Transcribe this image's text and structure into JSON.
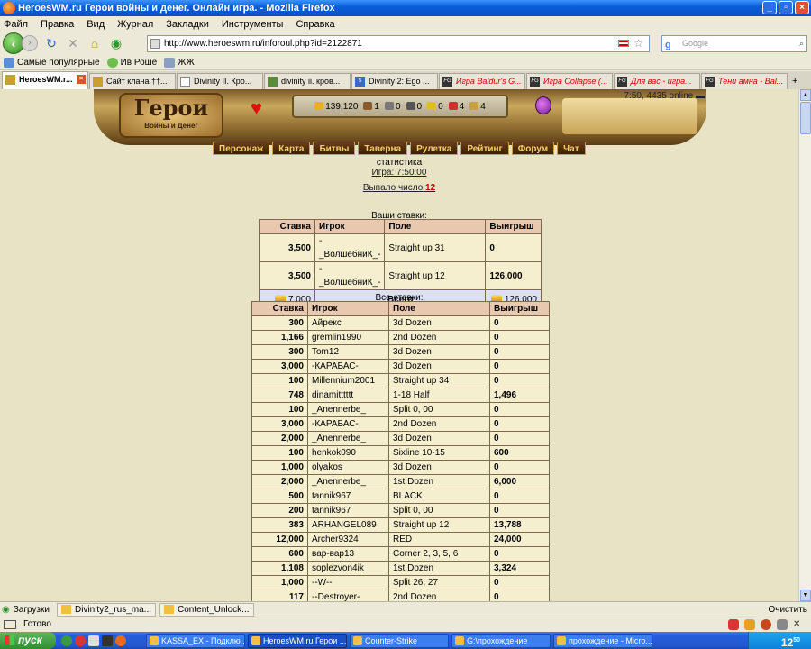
{
  "window": {
    "title": "HeroesWM.ru Герои войны и денег. Онлайн игра. - Mozilla Firefox"
  },
  "menu": [
    "Файл",
    "Правка",
    "Вид",
    "Журнал",
    "Закладки",
    "Инструменты",
    "Справка"
  ],
  "nav": {
    "url": "http://www.heroeswm.ru/inforoul.php?id=2122871",
    "search_placeholder": "Google"
  },
  "bookmarks": [
    "Самые популярные",
    "Ив Роше",
    "ЖЖ"
  ],
  "tabs": [
    {
      "label": "HeroesWM.r...",
      "active": true
    },
    {
      "label": "Сайт клана ††..."
    },
    {
      "label": "Divinity II. Кро..."
    },
    {
      "label": "divinity ii. кров..."
    },
    {
      "label": "Divinity 2: Ego ..."
    },
    {
      "label": "Игра Baldur's G...",
      "red": true
    },
    {
      "label": "Игра Collapse (...",
      "red": true
    },
    {
      "label": "Для вас - игра...",
      "red": true
    },
    {
      "label": "Тени амна - Bal...",
      "red": true
    }
  ],
  "game": {
    "logo_title": "Герои",
    "logo_sub": "Войны и Денег",
    "online": "7:50, 4435 online",
    "resources": [
      "139,120",
      "1",
      "0",
      "0",
      "0",
      "4",
      "4"
    ],
    "menu": [
      "Персонаж",
      "Карта",
      "Битвы",
      "Таверна",
      "Рулетка",
      "Рейтинг",
      "Форум",
      "Чат"
    ]
  },
  "stats": {
    "heading": "статистика",
    "game_link": "Игра: 7:50:00",
    "dropped_label": "Выпало число",
    "dropped_value": "12"
  },
  "my_bets": {
    "caption": "Ваши ставки:",
    "headers": [
      "Ставка",
      "Игрок",
      "Поле",
      "Выигрыш"
    ],
    "rows": [
      [
        "3,500",
        "-_ВолшебниК_-",
        "Straight up 31",
        "0"
      ],
      [
        "3,500",
        "-_ВолшебниК_-",
        "Straight up 12",
        "126,000"
      ]
    ],
    "total": {
      "bet": "7,000",
      "label": "Всего",
      "win": "126,000"
    }
  },
  "all_bets": {
    "caption": "Все ставки:",
    "headers": [
      "Ставка",
      "Игрок",
      "Поле",
      "Выигрыш"
    ],
    "rows": [
      [
        "300",
        "Айрекс",
        "3d Dozen",
        "0"
      ],
      [
        "1,166",
        "gremlin1990",
        "2nd Dozen",
        "0"
      ],
      [
        "300",
        "Tom12",
        "3d Dozen",
        "0"
      ],
      [
        "3,000",
        "-КАРАБАС-",
        "3d Dozen",
        "0"
      ],
      [
        "100",
        "Millennium2001",
        "Straight up 34",
        "0"
      ],
      [
        "748",
        "dinamitttttt",
        "1-18 Half",
        "1,496"
      ],
      [
        "100",
        "_Anennerbe_",
        "Split 0, 00",
        "0"
      ],
      [
        "3,000",
        "-КАРАБАС-",
        "2nd Dozen",
        "0"
      ],
      [
        "2,000",
        "_Anennerbe_",
        "3d Dozen",
        "0"
      ],
      [
        "100",
        "henkok090",
        "Sixline 10-15",
        "600"
      ],
      [
        "1,000",
        "olyakos",
        "3d Dozen",
        "0"
      ],
      [
        "2,000",
        "_Anennerbe_",
        "1st Dozen",
        "6,000"
      ],
      [
        "500",
        "tannik967",
        "BLACK",
        "0"
      ],
      [
        "200",
        "tannik967",
        "Split 0, 00",
        "0"
      ],
      [
        "383",
        "ARHANGEL089",
        "Straight up 12",
        "13,788"
      ],
      [
        "12,000",
        "Archer9324",
        "RED",
        "24,000"
      ],
      [
        "600",
        "вар-вар13",
        "Corner 2, 3, 5, 6",
        "0"
      ],
      [
        "1,108",
        "soplezvon4ik",
        "1st Dozen",
        "3,324"
      ],
      [
        "1,000",
        "--W--",
        "Split 26, 27",
        "0"
      ],
      [
        "117",
        "--Destroyer-",
        "2nd Dozen",
        "0"
      ]
    ]
  },
  "downloads": {
    "label": "Загрузки",
    "items": [
      "Divinity2_rus_ma...",
      "Content_Unlock..."
    ],
    "clear": "Очистить"
  },
  "status": "Готово",
  "taskbar": {
    "start": "пуск",
    "tasks": [
      "KASSA_EX - Подклю...",
      "HeroesWM.ru Герои ...",
      "Counter-Strike",
      "G:\\прохождение",
      "прохождение - Micro..."
    ],
    "clock": "12",
    "clock_min": "50"
  }
}
